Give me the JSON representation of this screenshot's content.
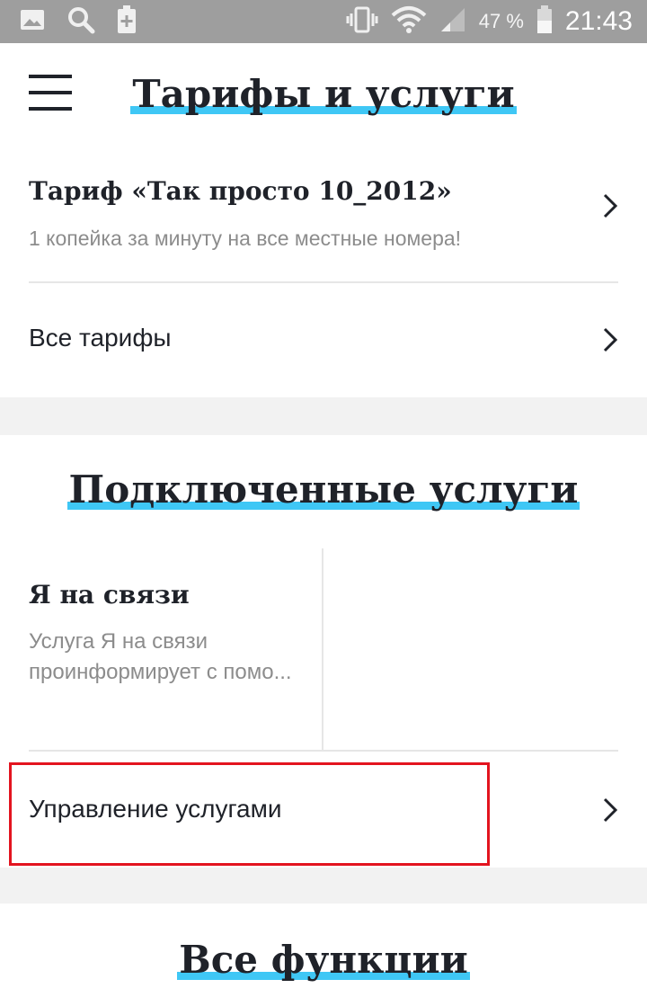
{
  "status_bar": {
    "battery_percent": "47 %",
    "time": "21:43",
    "icons": [
      "image-icon",
      "search-icon",
      "battery-plus-icon",
      "vibrate-icon",
      "wifi-icon",
      "signal-icon",
      "battery-icon"
    ]
  },
  "header": {
    "menu_icon": "hamburger-icon",
    "title": "Тарифы и услуги"
  },
  "tariff": {
    "current_title": "Тариф «Так просто 10_2012»",
    "current_desc": "1 копейка за минуту на все местные номера!",
    "all_label": "Все тарифы"
  },
  "services": {
    "title": "Подключенные услуги",
    "tile_title": "Я на связи",
    "tile_desc_line1": "Услуга Я на связи",
    "tile_desc_line2": "проинформирует с помо...",
    "manage_label": "Управление услугами"
  },
  "functions": {
    "title": "Все функции"
  },
  "colors": {
    "accent": "#3fc7f5",
    "highlight_border": "#e3141f",
    "status_bar": "#9e9e9e"
  }
}
